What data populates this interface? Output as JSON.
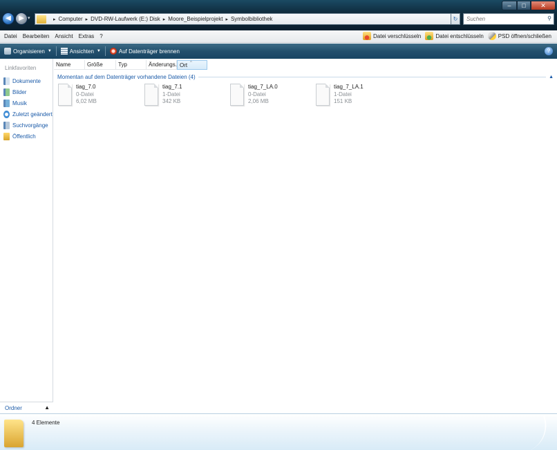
{
  "address": {
    "crumbs": [
      "Computer",
      "DVD-RW-Laufwerk (E:) Disk",
      "Moore_Beispielprojekt",
      "Symbolbibliothek"
    ],
    "search_placeholder": "Suchen"
  },
  "menu": {
    "items": [
      "Datei",
      "Bearbeiten",
      "Ansicht",
      "Extras",
      "?"
    ],
    "right_actions": [
      "Datei verschlüsseln",
      "Datei entschlüsseln",
      "PSD öffnen/schließen"
    ]
  },
  "toolbar": {
    "organize": "Organisieren",
    "views": "Ansichten",
    "burn": "Auf Datenträger brennen"
  },
  "nav": {
    "heading": "Linkfavoriten",
    "links": [
      "Dokumente",
      "Bilder",
      "Musik",
      "Zuletzt geändert",
      "Suchvorgänge",
      "Öffentlich"
    ],
    "folders_label": "Ordner"
  },
  "columns": [
    "Name",
    "Größe",
    "Typ",
    "Änderungs...",
    "Ort"
  ],
  "group": {
    "title": "Momentan auf dem Datenträger vorhandene Dateien (4)"
  },
  "files": [
    {
      "name": "tiag_7.0",
      "type": "0-Datei",
      "size": "6,02 MB"
    },
    {
      "name": "tiag_7.1",
      "type": "1-Datei",
      "size": "342 KB"
    },
    {
      "name": "tiag_7_LA.0",
      "type": "0-Datei",
      "size": "2,06 MB"
    },
    {
      "name": "tiag_7_LA.1",
      "type": "1-Datei",
      "size": "151 KB"
    }
  ],
  "details": {
    "count": "4 Elemente"
  },
  "colors": {
    "link_blue": "#1a5aa8",
    "toolbar_blue": "#22506d"
  }
}
